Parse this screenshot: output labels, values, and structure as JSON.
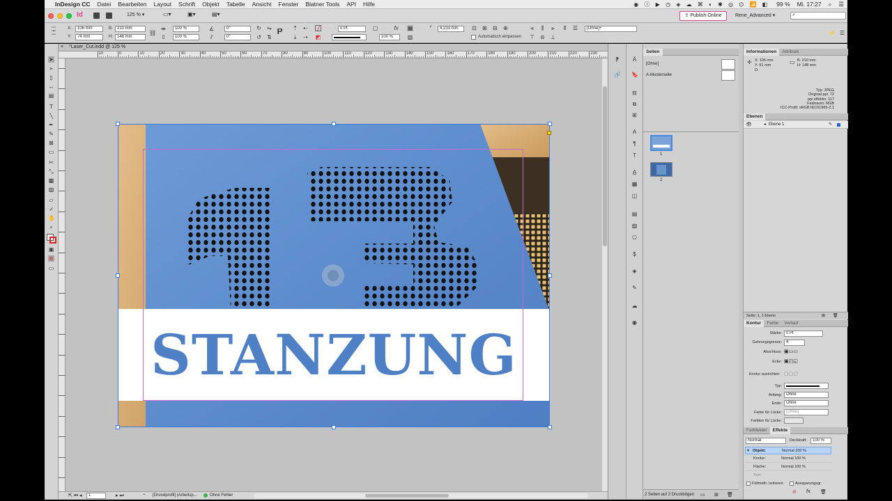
{
  "menubar": {
    "app_name": "InDesign CC",
    "items": [
      "Datei",
      "Bearbeiten",
      "Layout",
      "Schrift",
      "Objekt",
      "Tabelle",
      "Ansicht",
      "Fenster",
      "Blatner Tools",
      "API",
      "Hilfe"
    ],
    "battery": "99 %",
    "clock": "Mi. 17:27"
  },
  "appbar": {
    "logo": "Id",
    "zoom": "125 %",
    "publish_label": "Publish Online",
    "workspace": "Rene_Advanced",
    "search_placeholder": ""
  },
  "control": {
    "x": "106 mm",
    "y": "74 mm",
    "w": "210 mm",
    "h": "148 mm",
    "scale_x": "100 %",
    "scale_y": "100 %",
    "angle": "0°",
    "shear": "0°",
    "stroke_weight": "0 Pt",
    "opacity": "100 %",
    "dim_value": "4,233 mm",
    "object_style": "[Ohne]+",
    "auto_fit_label": "Automatisch einpassen"
  },
  "document": {
    "tab_title": "*Laser_Cut.indd @ 125 %",
    "ruler_marks": [
      "10",
      "0",
      "10",
      "20",
      "30",
      "40",
      "50",
      "60",
      "70",
      "80",
      "90",
      "100",
      "110",
      "120",
      "130",
      "140",
      "150",
      "160",
      "170",
      "180",
      "190",
      "200",
      "210",
      "220",
      "230"
    ],
    "headline": "STANZUNG",
    "big_number": "13"
  },
  "status": {
    "page_num": "1",
    "profile": "[Grundprofil] (Arbeitsp...",
    "preflight": "Ohne Fehler"
  },
  "pages_panel": {
    "title": "Seiten",
    "masters": [
      "[Ohne]",
      "A-Musterseite"
    ],
    "pages": [
      "1",
      "2"
    ],
    "footer": "2 Seiten auf 2 Druckbögen"
  },
  "info_panel": {
    "tabs": [
      "Informationen",
      "Attribute"
    ],
    "x": "X: 106 mm",
    "y": "Y: 91 mm",
    "d": "D:",
    "w": "B: 210 mm",
    "h": "H: 148 mm",
    "lines": [
      "Typ: JPEG",
      "Original ppi: 72",
      "ppi effektiv: 117",
      "Farbraum: RGB",
      "ICC-Profil: sRGB IEC61966-2.1"
    ]
  },
  "layers_panel": {
    "title": "Ebenen",
    "layers": [
      "Ebene 1"
    ],
    "footer": "Seite: 1, 1 Ebene"
  },
  "stroke_panel": {
    "tabs": [
      "Kontur",
      "Farbe",
      "Verlauf"
    ],
    "labels": {
      "weight": "Stärke:",
      "miter": "Gehrungsgrenze:",
      "cap": "Abschluss:",
      "corner": "Ecke:",
      "align": "Kontur ausrichten:",
      "type": "Typ:",
      "start": "Anfang:",
      "end": "Ende:",
      "gap_color": "Farbe für Lücke:",
      "gap_tint": "Farbton für Lücke:"
    },
    "values": {
      "weight": "0 Pt",
      "miter": "4",
      "start": "Ohne",
      "end": "Ohne",
      "gap_color": "[Ohne]"
    }
  },
  "effects_panel": {
    "tabs": [
      "Farbfelder",
      "Effekte"
    ],
    "blend_mode": "Normal",
    "opacity_label": "Deckkraft:",
    "opacity": "100 %",
    "rows": [
      {
        "label": "Objekt:",
        "value": "Normal 100 %"
      },
      {
        "label": "Kontur:",
        "value": "Normal 100 %"
      },
      {
        "label": "Fläche:",
        "value": "Normal 100 %"
      },
      {
        "label": "Text:",
        "value": ""
      }
    ],
    "checkbox_isolate": "Füllmeth. isolieren",
    "checkbox_knockout": "Aussparungsgr."
  },
  "colors": {
    "menubar_bg": "#ececec",
    "paper_blue": "#5e8fcf",
    "margin_guide": "#c46ad0",
    "frame_blue": "#3b7bdc",
    "headline_blue": "#4f7fc4"
  }
}
